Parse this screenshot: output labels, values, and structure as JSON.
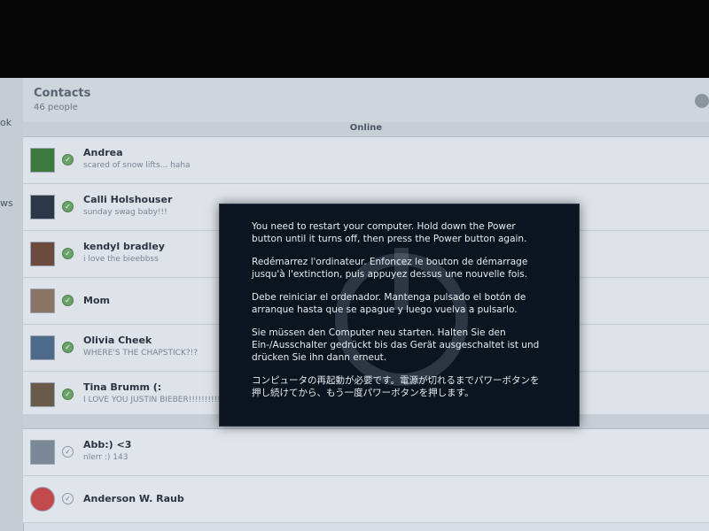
{
  "contacts": {
    "title": "Contacts",
    "count": "46 people"
  },
  "sidebar": {
    "labels": [
      "ok",
      "ws"
    ]
  },
  "sections": {
    "online": "Online"
  },
  "online_contacts": [
    {
      "name": "Andrea",
      "message": "scared of snow lifts... haha"
    },
    {
      "name": "Calli Holshouser",
      "message": "sunday swag baby!!!"
    },
    {
      "name": "kendyl bradley",
      "message": "i love the bieebbss"
    },
    {
      "name": "Mom",
      "message": ""
    },
    {
      "name": "Olivia Cheek",
      "message": "WHERE'S THE CHAPSTICK?!?"
    },
    {
      "name": "Tina Brumm (:",
      "message": "I LOVE YOU JUSTIN BIEBER!!!!!!!!!!"
    }
  ],
  "offline_contacts": [
    {
      "name": "Abb:) <3",
      "message": "nlerr :) 143"
    },
    {
      "name": "Anderson W. Raub",
      "message": ""
    }
  ],
  "dialog": {
    "messages": [
      "You need to restart your computer. Hold down the Power button until it turns off, then press the Power button again.",
      "Redémarrez l'ordinateur. Enfoncez le bouton de démarrage jusqu'à l'extinction, puis appuyez dessus une nouvelle fois.",
      "Debe reiniciar el ordenador. Mantenga pulsado el botón de arranque hasta que se apague y luego vuelva a pulsarlo.",
      "Sie müssen den Computer neu starten. Halten Sie den Ein-/Ausschalter gedrückt bis das Gerät ausgeschaltet ist und drücken Sie ihn dann erneut.",
      "コンピュータの再起動が必要です。電源が切れるまでパワーボタンを押し続けてから、もう一度パワーボタンを押します。"
    ],
    "icon": "power-icon"
  }
}
